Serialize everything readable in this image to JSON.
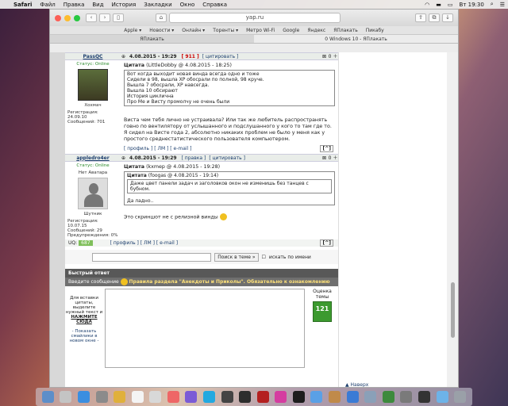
{
  "menubar": {
    "apple": "",
    "app": "Safari",
    "items": [
      "Файл",
      "Правка",
      "Вид",
      "История",
      "Закладки",
      "Окно",
      "Справка"
    ],
    "clock": "Вт 19:30"
  },
  "browser": {
    "address": "yap.ru",
    "favorites": [
      "Apple ▾",
      "Новости ▾",
      "Онлайн ▾",
      "Торенты ▾",
      "Метро Wi-Fi",
      "Google",
      "Яндекс",
      "ЯПлакать",
      "Пикабу"
    ],
    "tabs": [
      "ЯПлакать",
      "0 Windows 10 - ЯПлакать"
    ]
  },
  "posts": [
    {
      "user": "PassQC",
      "date": "4.08.2015 - 19:29",
      "rep": "[ 911 ]",
      "cite": "[ цитировать ]",
      "status": "Статус: Online",
      "title": "Хохмач",
      "reg": "Регистрация: 24.09.10",
      "msgs": "Сообщений: 701",
      "quote_head": "Цитата",
      "quote_src": "(LittleDobby @ 4.08.2015 - 18:25)",
      "quote_lines": [
        "Вот когда выходит новая винда всегда одно и тоже",
        "Сидели в 98, вышла XP обосрали по полной, 98 круче.",
        "Вышла 7 обосрали, XP навсегда.",
        "Вышла 10 обсирают",
        "История циклична",
        "Про Ме и Висту промолчу не очень были"
      ],
      "text": "Виста чем тебя лично не устраивала? Или так же любитель распространять говно по вентилятору от услышанного и подслушанного у кого то там где то. Я сидел на Висте года 2, абсолютно никаких проблем не было у меня как у простого среднестатистического пользователя компьютером.",
      "foot": "[ профиль ] [ ЛМ ] [ e-mail ]",
      "up": "[^]",
      "vote": "0"
    },
    {
      "user": "appledro4er",
      "date": "4.08.2015 - 19:29",
      "rep": "[ правка ]",
      "cite": "[ цитировать ]",
      "status": "Статус: Online",
      "avatar_label": "Нет Аватара",
      "title": "Шутник",
      "reg": "Регистрация: 10.07.15",
      "msgs": "Сообщений: 29",
      "warn": "Предупреждения: 0%",
      "quote_head": "Цитата",
      "quote_src": "(kxmep @ 4.08.2015 - 19:28)",
      "inner_head": "Цитата",
      "inner_src": "(foogas @ 4.08.2015 - 19:14)",
      "inner_text": "Даже цвет панели задач и заголовков окон не изменишь без танцев с бубном.",
      "quote_text": "Да ладно..",
      "text": "Это скриншот не с релизной винды",
      "uq": "UQ:",
      "uq_val": "687",
      "foot": "[ профиль ] [ ЛМ ] [ e-mail ]",
      "up": "[^]",
      "vote": "0"
    }
  ],
  "search": {
    "button": "Поиск в теме »",
    "checkbox": "искать по имени"
  },
  "quick": {
    "header": "Быстрый ответ",
    "intro": "Введите сообщение",
    "rules": "Правила раздела \"Анекдоты и Приколы\". Обязательно к ознакомлению",
    "left1": "Для вставки цитаты, выделите нужный текст и",
    "left2": "НАЖМИТЕ СЮДА",
    "left3": "- Показать смайлики в новом окне -",
    "rating_label": "Оценка темы",
    "rating": "121"
  },
  "up_link": "▲ Наверх"
}
